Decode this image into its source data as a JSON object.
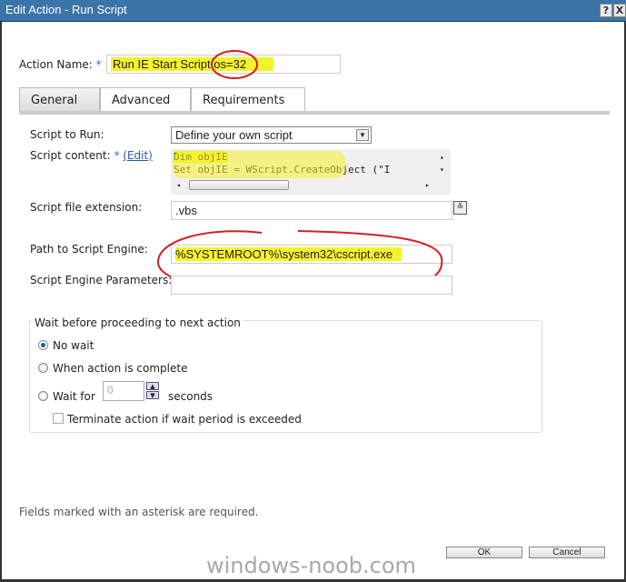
{
  "window": {
    "title": "Edit Action - Run Script",
    "help_label": "?",
    "close_label": "X"
  },
  "action_name": {
    "label": "Action Name:",
    "required": "*",
    "value": "Run IE Start Script os=32"
  },
  "tabs": [
    {
      "label": "General",
      "active": true
    },
    {
      "label": "Advanced"
    },
    {
      "label": "Requirements"
    }
  ],
  "general": {
    "script_to_run": {
      "label": "Script to Run:",
      "value": "Define your own script"
    },
    "script_content": {
      "label": "Script content:",
      "required": "*",
      "edit_link": "(Edit)",
      "lines": [
        "Dim objIE",
        "Set objIE = WScript.CreateObject (\"I"
      ]
    },
    "extension": {
      "label": "Script file extension:",
      "value": ".vbs"
    },
    "engine_path": {
      "label": "Path to Script Engine:",
      "value": "%SYSTEMROOT%\\system32\\cscript.exe"
    },
    "engine_params": {
      "label": "Script Engine Parameters:",
      "value": ""
    }
  },
  "wait": {
    "legend": "Wait before proceeding to next action",
    "options": [
      {
        "label": "No wait",
        "selected": true
      },
      {
        "label": "When action is complete",
        "selected": false
      },
      {
        "label": "Wait for",
        "selected": false
      }
    ],
    "seconds_value": "0",
    "seconds_label": "seconds",
    "terminate_label": "Terminate action if wait period is exceeded",
    "terminate_checked": false
  },
  "footer": {
    "note": "Fields marked with an asterisk are required.",
    "ok": "OK",
    "cancel": "Cancel"
  },
  "watermark": "windows-noob.com",
  "colors": {
    "titlebar": "#3a74a8",
    "highlight": "#f5f22b",
    "annotation": "#d22020"
  }
}
